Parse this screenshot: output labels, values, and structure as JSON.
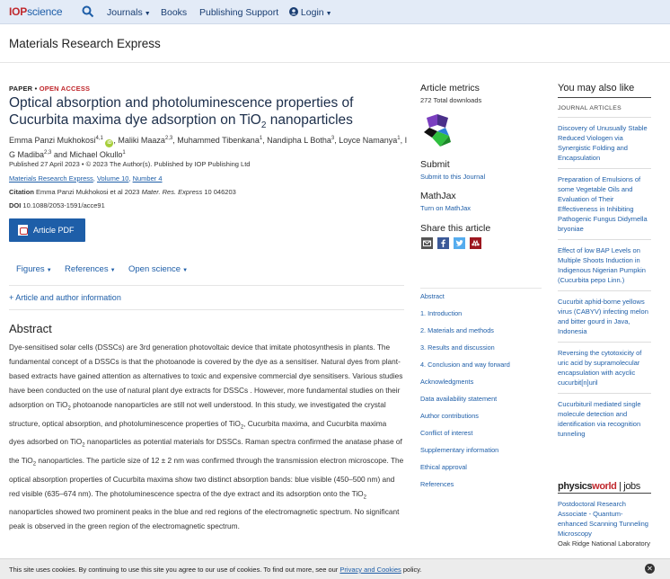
{
  "header": {
    "logo_iop": "IOP",
    "logo_science": "science",
    "nav": [
      {
        "label": "Journals",
        "has_caret": true
      },
      {
        "label": "Books",
        "has_caret": false
      },
      {
        "label": "Publishing Support",
        "has_caret": false
      },
      {
        "label": "Login",
        "has_caret": true
      }
    ]
  },
  "journal": {
    "title": "Materials Research Express"
  },
  "article": {
    "type": "PAPER",
    "separator": " • ",
    "open_access": "OPEN ACCESS",
    "title_part1": "Optical absorption and photoluminescence properties of Cucurbita maxima dye adsorption on TiO",
    "title_sub": "2",
    "title_part2": " nanoparticles",
    "authors_line1": "Emma Panzi Mukhokosi",
    "authors_line1_sup": "4,1",
    "authors_rest_1": ", Maliki Maaza",
    "authors_rest_1_sup": "2,3",
    "authors_rest_2": ", Muhammed Tibenkana",
    "authors_rest_2_sup": "1",
    "authors_rest_3": ", Nandipha L Botha",
    "authors_rest_3_sup": "3",
    "authors_rest_4": ", Loyce Namanya",
    "authors_rest_4_sup": "1",
    "authors_rest_5": ", I G Madiba",
    "authors_rest_5_sup": "2,3",
    "authors_rest_6": " and Michael Okullo",
    "authors_rest_6_sup": "1",
    "published": "Published 27 April 2023 • © 2023 The Author(s). Published by IOP Publishing Ltd",
    "link_journal": "Materials Research Express",
    "link_volume": "Volume 10",
    "link_number": "Number 4",
    "citation_label": "Citation",
    "citation_text": " Emma Panzi Mukhokosi et al 2023 ",
    "citation_journal": "Mater. Res. Express",
    "citation_end": " 10 046203",
    "doi_label": "DOI",
    "doi_value": " 10.1088/2053-1591/acce91",
    "pdf_button": "Article PDF"
  },
  "tabs": [
    {
      "label": "Figures"
    },
    {
      "label": "References"
    },
    {
      "label": "Open science"
    }
  ],
  "article_author_info": "+ Article and author information",
  "abstract": {
    "title": "Abstract",
    "p1": "Dye-sensitised solar cells (DSSCs) are 3rd generation photovoltaic device that imitate photosynthesis in plants. The fundamental concept of a DSSCs is that the photoanode is covered by the dye as a sensitiser. Natural dyes from plant-based extracts have gained attention as alternatives to toxic and expensive commercial dye sensitisers. Various studies have been conducted on the use of natural plant dye extracts for DSSCs . However, more fundamental studies on their adsorption on TiO",
    "p2": " photoanode nanoparticles are still not well understood. In this study, we investigated the crystal structure, optical absorption, and photoluminescence properties of TiO",
    "p3": ", Cucurbita maxima, and Cucurbita maxima dyes adsorbed on TiO",
    "p4": " nanoparticles as potential materials for DSSCs. Raman spectra confirmed the anatase phase of the TiO",
    "p5": " nanoparticles. The particle size of 12 ± 2 nm was confirmed through the transmission electron microscope. The optical absorption properties of Cucurbita maxima show two distinct absorption bands: blue visible (450–500 nm) and red visible (635–674 nm). The photoluminescence spectra of the dye extract and its adsorption onto the TiO",
    "p6": " nanoparticles showed two prominent peaks in the blue and red regions of the electromagnetic spectrum. No significant peak is observed in the green region of the electromagnetic spectrum.",
    "sub": "2"
  },
  "metrics": {
    "title": "Article metrics",
    "downloads": "272 Total downloads"
  },
  "submit": {
    "title": "Submit",
    "link": "Submit to this Journal"
  },
  "mathjax": {
    "title": "MathJax",
    "link": "Turn on MathJax"
  },
  "share": {
    "title": "Share this article"
  },
  "toc": [
    "Abstract",
    "1. Introduction",
    "2. Materials and methods",
    "3. Results and discussion",
    "4. Conclusion and way forward",
    "Acknowledgments",
    "Data availability statement",
    "Author contributions",
    "Conflict of interest",
    "Supplementary information",
    "Ethical approval",
    "References"
  ],
  "related": {
    "title": "You may also like",
    "subtitle": "JOURNAL ARTICLES",
    "items": [
      "Discovery of Unusually Stable Reduced Viologen via Synergistic Folding and Encapsulation",
      "Preparation of Emulsions of some Vegetable Oils and Evaluation of Their Effectiveness in Inhibiting Pathogenic Fungus Didymella bryoniae",
      "Effect of low BAP Levels on Multiple Shoots Induction in Indigenous Nigerian Pumpkin (Cucurbita pepo Linn.)",
      "Cucurbit aphid-borne yellows virus (CABYV) infecting melon and bitter gourd in Java, Indonesia",
      "Reversing the cytotoxicity of uric acid by supramolecular encapsulation with acyclic cucurbit[n]uril",
      "Cucurbituril mediated single molecule detection and identification via recognition tunneling"
    ]
  },
  "jobs": {
    "brand_a": "physics",
    "brand_b": "world",
    "brand_c": "jobs",
    "job_title": "Postdoctoral Research Associate - Quantum-enhanced Scanning Tunneling Microscopy",
    "job_org": "Oak Ridge National Laboratory"
  },
  "cookie": {
    "text": "This site uses cookies. By continuing to use this site you agree to our use of cookies. To find out more, see our ",
    "link": "Privacy and Cookies",
    "end": " policy."
  },
  "colors": {
    "brand_blue": "#1e5ea8",
    "brand_red": "#c0282d",
    "header_bg": "#e3ebf7"
  }
}
